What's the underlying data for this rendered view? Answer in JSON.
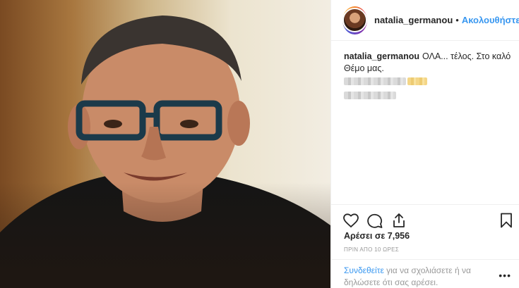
{
  "post": {
    "username": "natalia_germanou",
    "separator": "•",
    "follow_label": "Ακολουθήστε",
    "caption": "ΟΛΑ... τέλος. Στο καλό Θέμο μας.",
    "likes": "Αρέσει σε 7,956",
    "time": "ΠΡΙΝ ΑΠΟ 10 ΩΡΕΣ"
  },
  "icons": {
    "like": "heart-icon",
    "comment": "comment-icon",
    "share": "share-icon",
    "save": "bookmark-icon",
    "more": "more-icon"
  },
  "comment": {
    "login_link": "Συνδεθείτε",
    "prompt": " για να σχολιάσετε ή να δηλώσετε ότι σας αρέσει.",
    "more_glyph": "•••"
  },
  "colors": {
    "link": "#3897f0",
    "text": "#262626",
    "muted": "#999999"
  }
}
